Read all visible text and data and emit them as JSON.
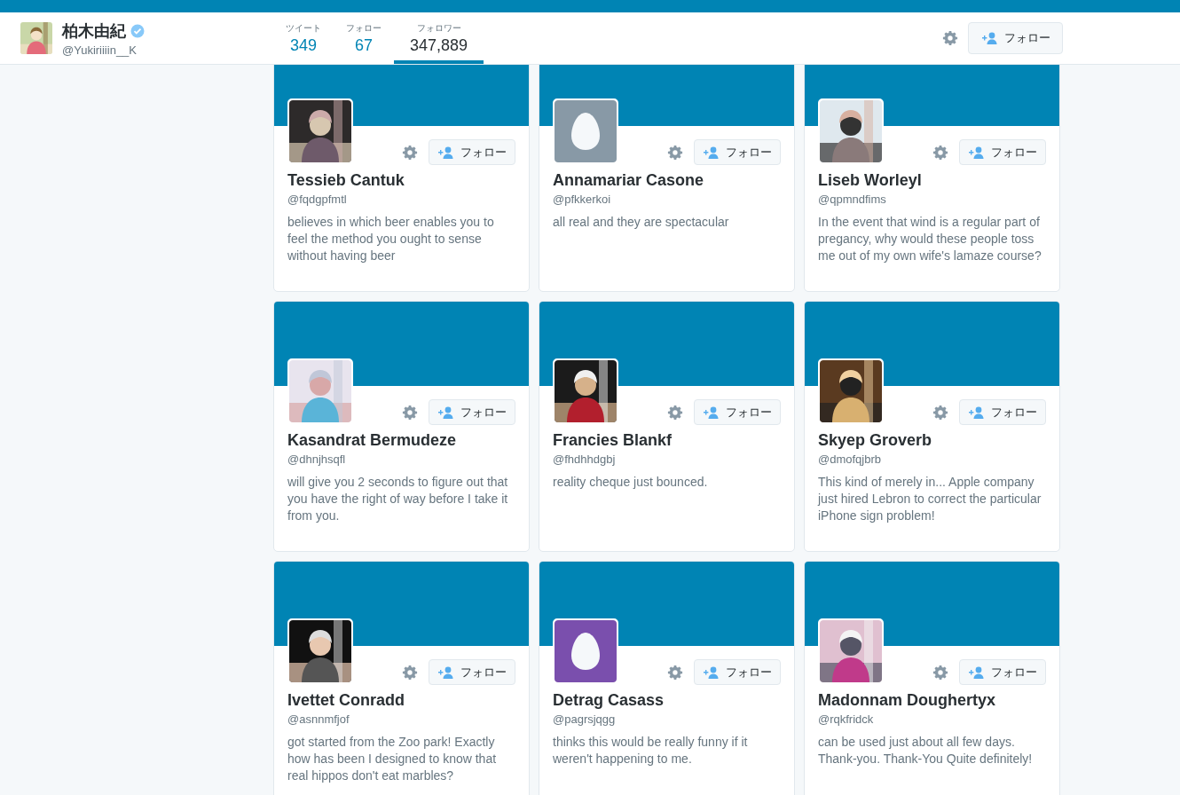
{
  "profile": {
    "name": "柏木由紀",
    "verified": true,
    "handle": "@Yukiriiiin__K"
  },
  "stats": [
    {
      "label": "ツイート",
      "value": "349",
      "selected": false
    },
    {
      "label": "フォロー",
      "value": "67",
      "selected": false
    },
    {
      "label": "フォロワー",
      "value": "347,889",
      "selected": true
    }
  ],
  "header_button": "フォロー",
  "cards": [
    {
      "name": "Tessieb Cantuk",
      "handle": "@fqdgpfmtl",
      "bio": "believes in which beer enables you to feel the method you ought to sense without having beer",
      "button": "フォロー"
    },
    {
      "name": "Annamariar Casone",
      "handle": "@pfkkerkoi",
      "bio": "all real and they are spectacular",
      "button": "フォロー",
      "avatar": {
        "kind": "egg",
        "color": "#8899a6"
      }
    },
    {
      "name": "Liseb Worleyl",
      "handle": "@qpmndfims",
      "bio": "In the event that wind is a regular part of pregancy, why would these people toss me out of my own wife's lamaze course?",
      "button": "フォロー"
    },
    {
      "name": "Kasandrat Bermudeze",
      "handle": "@dhnjhsqfl",
      "bio": "will give you 2 seconds to figure out that you have the right of way before I take it from you.",
      "button": "フォロー"
    },
    {
      "name": "Francies Blankf",
      "handle": "@fhdhhdgbj",
      "bio": "reality cheque just bounced.",
      "button": "フォロー"
    },
    {
      "name": "Skyep Groverb",
      "handle": "@dmofqjbrb",
      "bio": "This kind of merely in... Apple company just hired Lebron to correct the particular iPhone sign problem!",
      "button": "フォロー"
    },
    {
      "name": "Ivettet Conradd",
      "handle": "@asnnmfjof",
      "bio": "got started from the Zoo park! Exactly how has been I designed to know that real hippos don't eat marbles?",
      "button": "フォロー"
    },
    {
      "name": "Detrag Casass",
      "handle": "@pagrsjqgg",
      "bio": "thinks this would be really funny if it weren't happening to me.",
      "button": "フォロー",
      "avatar": {
        "kind": "egg",
        "color": "#7a4fad"
      }
    },
    {
      "name": "Madonnam Doughertyx",
      "handle": "@rqkfridck",
      "bio": "can be used just about all few days. Thank-you. Thank-You Quite definitely!",
      "button": "フォロー"
    }
  ]
}
